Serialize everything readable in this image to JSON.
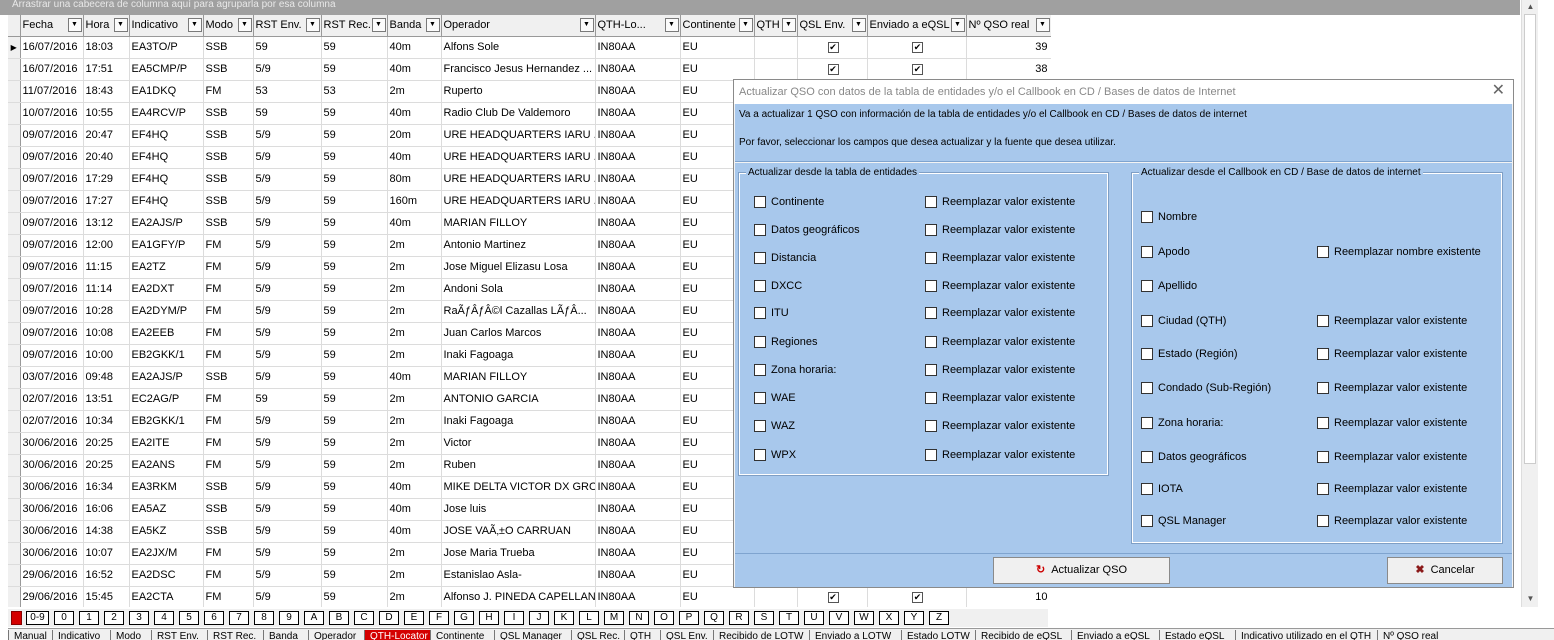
{
  "groupbar_text": "Arrastrar una cabecera de columna aquí para agruparla por esa columna",
  "columns": [
    "Fecha",
    "Hora",
    "Indicativo",
    "Modo",
    "RST Env.",
    "RST Rec.",
    "Banda",
    "Operador",
    "QTH-Lo...",
    "Continente",
    "QTH",
    "QSL Env.",
    "Enviado a eQSL",
    "Nº QSO real"
  ],
  "rows": [
    {
      "fecha": "16/07/2016",
      "hora": "18:03",
      "ind": "EA3TO/P",
      "modo": "SSB",
      "rste": "59",
      "rstr": "59",
      "banda": "40m",
      "op": "Alfons Sole",
      "loc": "IN80AA",
      "cont": "EU",
      "qsl": true,
      "eqsl": true,
      "num": "39"
    },
    {
      "fecha": "16/07/2016",
      "hora": "17:51",
      "ind": "EA5CMP/P",
      "modo": "SSB",
      "rste": "5/9",
      "rstr": "59",
      "banda": "40m",
      "op": "Francisco Jesus Hernandez ...",
      "loc": "IN80AA",
      "cont": "EU",
      "qsl": true,
      "eqsl": true,
      "num": "38"
    },
    {
      "fecha": "11/07/2016",
      "hora": "18:43",
      "ind": "EA1DKQ",
      "modo": "FM",
      "rste": "53",
      "rstr": "53",
      "banda": "2m",
      "op": "Ruperto",
      "loc": "IN80AA",
      "cont": "EU"
    },
    {
      "fecha": "10/07/2016",
      "hora": "10:55",
      "ind": "EA4RCV/P",
      "modo": "SSB",
      "rste": "59",
      "rstr": "59",
      "banda": "40m",
      "op": "Radio Club De Valdemoro",
      "loc": "IN80AA",
      "cont": "EU"
    },
    {
      "fecha": "09/07/2016",
      "hora": "20:47",
      "ind": "EF4HQ",
      "modo": "SSB",
      "rste": "5/9",
      "rstr": "59",
      "banda": "20m",
      "op": "URE HEADQUARTERS IARU ...",
      "loc": "IN80AA",
      "cont": "EU"
    },
    {
      "fecha": "09/07/2016",
      "hora": "20:40",
      "ind": "EF4HQ",
      "modo": "SSB",
      "rste": "5/9",
      "rstr": "59",
      "banda": "40m",
      "op": "URE HEADQUARTERS IARU ...",
      "loc": "IN80AA",
      "cont": "EU"
    },
    {
      "fecha": "09/07/2016",
      "hora": "17:29",
      "ind": "EF4HQ",
      "modo": "SSB",
      "rste": "5/9",
      "rstr": "59",
      "banda": "80m",
      "op": "URE HEADQUARTERS IARU ...",
      "loc": "IN80AA",
      "cont": "EU"
    },
    {
      "fecha": "09/07/2016",
      "hora": "17:27",
      "ind": "EF4HQ",
      "modo": "SSB",
      "rste": "5/9",
      "rstr": "59",
      "banda": "160m",
      "op": "URE HEADQUARTERS IARU ...",
      "loc": "IN80AA",
      "cont": "EU"
    },
    {
      "fecha": "09/07/2016",
      "hora": "13:12",
      "ind": "EA2AJS/P",
      "modo": "SSB",
      "rste": "5/9",
      "rstr": "59",
      "banda": "40m",
      "op": "MARIAN FILLOY",
      "loc": "IN80AA",
      "cont": "EU"
    },
    {
      "fecha": "09/07/2016",
      "hora": "12:00",
      "ind": "EA1GFY/P",
      "modo": "FM",
      "rste": "5/9",
      "rstr": "59",
      "banda": "2m",
      "op": "Antonio Martinez",
      "loc": "IN80AA",
      "cont": "EU"
    },
    {
      "fecha": "09/07/2016",
      "hora": "11:15",
      "ind": "EA2TZ",
      "modo": "FM",
      "rste": "5/9",
      "rstr": "59",
      "banda": "2m",
      "op": "Jose Miguel Elizasu Losa",
      "loc": "IN80AA",
      "cont": "EU"
    },
    {
      "fecha": "09/07/2016",
      "hora": "11:14",
      "ind": "EA2DXT",
      "modo": "FM",
      "rste": "5/9",
      "rstr": "59",
      "banda": "2m",
      "op": "Andoni Sola",
      "loc": "IN80AA",
      "cont": "EU"
    },
    {
      "fecha": "09/07/2016",
      "hora": "10:28",
      "ind": "EA2DYM/P",
      "modo": "FM",
      "rste": "5/9",
      "rstr": "59",
      "banda": "2m",
      "op": "RaÃƒÂƒÂ©l Cazallas LÃƒÂ...",
      "loc": "IN80AA",
      "cont": "EU"
    },
    {
      "fecha": "09/07/2016",
      "hora": "10:08",
      "ind": "EA2EEB",
      "modo": "FM",
      "rste": "5/9",
      "rstr": "59",
      "banda": "2m",
      "op": "Juan Carlos Marcos",
      "loc": "IN80AA",
      "cont": "EU"
    },
    {
      "fecha": "09/07/2016",
      "hora": "10:00",
      "ind": "EB2GKK/1",
      "modo": "FM",
      "rste": "5/9",
      "rstr": "59",
      "banda": "2m",
      "op": "Inaki Fagoaga",
      "loc": "IN80AA",
      "cont": "EU"
    },
    {
      "fecha": "03/07/2016",
      "hora": "09:48",
      "ind": "EA2AJS/P",
      "modo": "SSB",
      "rste": "5/9",
      "rstr": "59",
      "banda": "40m",
      "op": "MARIAN FILLOY",
      "loc": "IN80AA",
      "cont": "EU"
    },
    {
      "fecha": "02/07/2016",
      "hora": "13:51",
      "ind": "EC2AG/P",
      "modo": "FM",
      "rste": "59",
      "rstr": "59",
      "banda": "2m",
      "op": "ANTONIO GARCIA",
      "loc": "IN80AA",
      "cont": "EU"
    },
    {
      "fecha": "02/07/2016",
      "hora": "10:34",
      "ind": "EB2GKK/1",
      "modo": "FM",
      "rste": "5/9",
      "rstr": "59",
      "banda": "2m",
      "op": "Inaki Fagoaga",
      "loc": "IN80AA",
      "cont": "EU"
    },
    {
      "fecha": "30/06/2016",
      "hora": "20:25",
      "ind": "EA2ITE",
      "modo": "FM",
      "rste": "5/9",
      "rstr": "59",
      "banda": "2m",
      "op": "Victor",
      "loc": "IN80AA",
      "cont": "EU"
    },
    {
      "fecha": "30/06/2016",
      "hora": "20:25",
      "ind": "EA2ANS",
      "modo": "FM",
      "rste": "5/9",
      "rstr": "59",
      "banda": "2m",
      "op": "Ruben",
      "loc": "IN80AA",
      "cont": "EU"
    },
    {
      "fecha": "30/06/2016",
      "hora": "16:34",
      "ind": "EA3RKM",
      "modo": "SSB",
      "rste": "5/9",
      "rstr": "59",
      "banda": "40m",
      "op": "MIKE DELTA VICTOR DX GRO...",
      "loc": "IN80AA",
      "cont": "EU"
    },
    {
      "fecha": "30/06/2016",
      "hora": "16:06",
      "ind": "EA5AZ",
      "modo": "SSB",
      "rste": "5/9",
      "rstr": "59",
      "banda": "40m",
      "op": "Jose luis",
      "loc": "IN80AA",
      "cont": "EU"
    },
    {
      "fecha": "30/06/2016",
      "hora": "14:38",
      "ind": "EA5KZ",
      "modo": "SSB",
      "rste": "5/9",
      "rstr": "59",
      "banda": "40m",
      "op": "JOSE VAÃ‚±O CARRUAN",
      "loc": "IN80AA",
      "cont": "EU"
    },
    {
      "fecha": "30/06/2016",
      "hora": "10:07",
      "ind": "EA2JX/M",
      "modo": "FM",
      "rste": "5/9",
      "rstr": "59",
      "banda": "2m",
      "op": "Jose Maria Trueba",
      "loc": "IN80AA",
      "cont": "EU"
    },
    {
      "fecha": "29/06/2016",
      "hora": "16:52",
      "ind": "EA2DSC",
      "modo": "FM",
      "rste": "5/9",
      "rstr": "59",
      "banda": "2m",
      "op": "Estanislao Asla-",
      "loc": "IN80AA",
      "cont": "EU"
    },
    {
      "fecha": "29/06/2016",
      "hora": "15:45",
      "ind": "EA2CTA",
      "modo": "FM",
      "rste": "5/9",
      "rstr": "59",
      "banda": "2m",
      "op": "Alfonso J. PINEDA CAPELLAN",
      "loc": "IN80AA",
      "cont": "EU",
      "qsl": true,
      "eqsl": true,
      "num": "10"
    }
  ],
  "letters": [
    "0-9",
    "0",
    "1",
    "2",
    "3",
    "4",
    "5",
    "6",
    "7",
    "8",
    "9",
    "A",
    "B",
    "C",
    "D",
    "E",
    "F",
    "G",
    "H",
    "I",
    "J",
    "K",
    "L",
    "M",
    "N",
    "O",
    "P",
    "Q",
    "R",
    "S",
    "T",
    "U",
    "V",
    "W",
    "X",
    "Y",
    "Z"
  ],
  "bottom_tabs": [
    "Manual",
    "Indicativo",
    "Modo",
    "RST Env.",
    "RST Rec.",
    "Banda",
    "Operador",
    "QTH-Locator",
    "Continente",
    "QSL Manager",
    "QSL Rec.",
    "QTH",
    "QSL Env.",
    "Recibido de LOTW",
    "Enviado a LOTW",
    "Estado LOTW",
    "Recibido de eQSL",
    "Enviado a eQSL",
    "Estado eQSL",
    "Indicativo utilizado en el QTH",
    "Nº QSO real"
  ],
  "dialog": {
    "title": "Actualizar QSO con datos de la tabla de entidades y/o el Callbook en CD / Bases de datos de Internet",
    "line1": "Va a actualizar 1 QSO con información de la tabla de entidades y/o el Callbook en CD / Bases de datos de internet",
    "line2": "Por favor, seleccionar los campos que desea actualizar y la fuente que desea utilizar.",
    "left_group": "Actualizar desde la tabla de entidades",
    "left_fields": [
      "Continente",
      "Datos geográficos",
      "Distancia",
      "DXCC",
      "ITU",
      "Regiones",
      "Zona horaria:",
      "WAE",
      "WAZ",
      "WPX"
    ],
    "replace_label": "Reemplazar valor existente",
    "right_group": "Actualizar desde el Callbook en CD / Base de datos de internet",
    "right_fields": [
      "Nombre",
      "Apodo",
      "Apellido",
      "Ciudad (QTH)",
      "Estado (Región)",
      "Condado (Sub-Región)",
      "Zona horaria:",
      "Datos geográficos",
      "IOTA",
      "QSL Manager"
    ],
    "right_replace": [
      "",
      "Reemplazar nombre existente",
      "",
      "Reemplazar valor existente",
      "Reemplazar valor existente",
      "Reemplazar valor existente",
      "Reemplazar valor existente",
      "Reemplazar valor existente",
      "Reemplazar valor existente",
      "Reemplazar valor existente"
    ],
    "update_button": "Actualizar QSO",
    "cancel_button": "Cancelar"
  },
  "colors": {
    "dialog_bg": "#a8c8ec",
    "active_tab": "#d40000"
  }
}
